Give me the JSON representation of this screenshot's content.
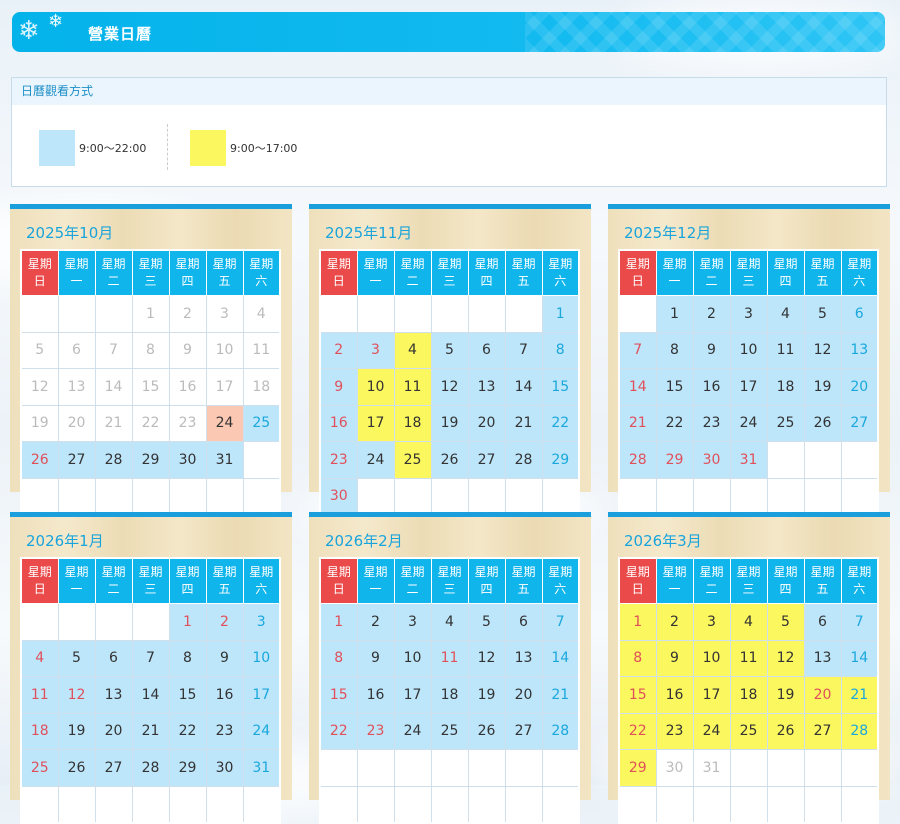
{
  "header": {
    "title": "營業日曆"
  },
  "legend": {
    "title": "日曆觀看方式",
    "items": [
      {
        "color": "#bde6fb",
        "label": "9:00～22:00"
      },
      {
        "color": "#fbf75e",
        "label": "9:00～17:00"
      }
    ]
  },
  "weekdays": [
    [
      "星期",
      "日"
    ],
    [
      "星期",
      "一"
    ],
    [
      "星期",
      "二"
    ],
    [
      "星期",
      "三"
    ],
    [
      "星期",
      "四"
    ],
    [
      "星期",
      "五"
    ],
    [
      "星期",
      "六"
    ]
  ],
  "colors": {
    "b": "#bde6fb",
    "y": "#fbf75e",
    "o": "#fbc9b3"
  },
  "months": [
    {
      "title": "2025年10月",
      "start": 3,
      "days": 31,
      "rows": 6,
      "fill": {
        "24": "o",
        "25": "b",
        "26": "b",
        "27": "b",
        "28": "b",
        "29": "b",
        "30": "b",
        "31": "b"
      },
      "greyUntil": 23
    },
    {
      "title": "2025年11月",
      "start": 6,
      "days": 30,
      "rows": 6,
      "fill": {
        "1": "b",
        "2": "b",
        "3": "b",
        "4": "y",
        "5": "b",
        "6": "b",
        "7": "b",
        "8": "b",
        "9": "b",
        "10": "y",
        "11": "y",
        "12": "b",
        "13": "b",
        "14": "b",
        "15": "b",
        "16": "b",
        "17": "y",
        "18": "y",
        "19": "b",
        "20": "b",
        "21": "b",
        "22": "b",
        "23": "b",
        "24": "b",
        "25": "y",
        "26": "b",
        "27": "b",
        "28": "b",
        "29": "b",
        "30": "b"
      },
      "red": [
        3
      ]
    },
    {
      "title": "2025年12月",
      "start": 1,
      "days": 31,
      "rows": 6,
      "fill": {
        "1": "b",
        "2": "b",
        "3": "b",
        "4": "b",
        "5": "b",
        "6": "b",
        "7": "b",
        "8": "b",
        "9": "b",
        "10": "b",
        "11": "b",
        "12": "b",
        "13": "b",
        "14": "b",
        "15": "b",
        "16": "b",
        "17": "b",
        "18": "b",
        "19": "b",
        "20": "b",
        "21": "b",
        "22": "b",
        "23": "b",
        "24": "b",
        "25": "b",
        "26": "b",
        "27": "b",
        "28": "b",
        "29": "b",
        "30": "b",
        "31": "b"
      },
      "red": [
        29,
        30,
        31
      ]
    },
    {
      "title": "2026年1月",
      "start": 4,
      "days": 31,
      "rows": 6,
      "fill": {
        "1": "b",
        "2": "b",
        "3": "b",
        "4": "b",
        "5": "b",
        "6": "b",
        "7": "b",
        "8": "b",
        "9": "b",
        "10": "b",
        "11": "b",
        "12": "b",
        "13": "b",
        "14": "b",
        "15": "b",
        "16": "b",
        "17": "b",
        "18": "b",
        "19": "b",
        "20": "b",
        "21": "b",
        "22": "b",
        "23": "b",
        "24": "b",
        "25": "b",
        "26": "b",
        "27": "b",
        "28": "b",
        "29": "b",
        "30": "b",
        "31": "b"
      },
      "red": [
        1,
        2,
        12
      ]
    },
    {
      "title": "2026年2月",
      "start": 0,
      "days": 28,
      "rows": 6,
      "fill": {
        "1": "b",
        "2": "b",
        "3": "b",
        "4": "b",
        "5": "b",
        "6": "b",
        "7": "b",
        "8": "b",
        "9": "b",
        "10": "b",
        "11": "b",
        "12": "b",
        "13": "b",
        "14": "b",
        "15": "b",
        "16": "b",
        "17": "b",
        "18": "b",
        "19": "b",
        "20": "b",
        "21": "b",
        "22": "b",
        "23": "b",
        "24": "b",
        "25": "b",
        "26": "b",
        "27": "b",
        "28": "b"
      },
      "red": [
        11,
        23
      ]
    },
    {
      "title": "2026年3月",
      "start": 0,
      "days": 31,
      "rows": 6,
      "fill": {
        "1": "y",
        "2": "y",
        "3": "y",
        "4": "y",
        "5": "y",
        "6": "b",
        "7": "b",
        "8": "y",
        "9": "y",
        "10": "y",
        "11": "y",
        "12": "y",
        "13": "b",
        "14": "b",
        "15": "y",
        "16": "y",
        "17": "y",
        "18": "y",
        "19": "y",
        "20": "y",
        "21": "y",
        "22": "y",
        "23": "y",
        "24": "y",
        "25": "y",
        "26": "y",
        "27": "y",
        "28": "y",
        "29": "y"
      },
      "red": [
        20
      ],
      "greyFrom": 30
    }
  ]
}
